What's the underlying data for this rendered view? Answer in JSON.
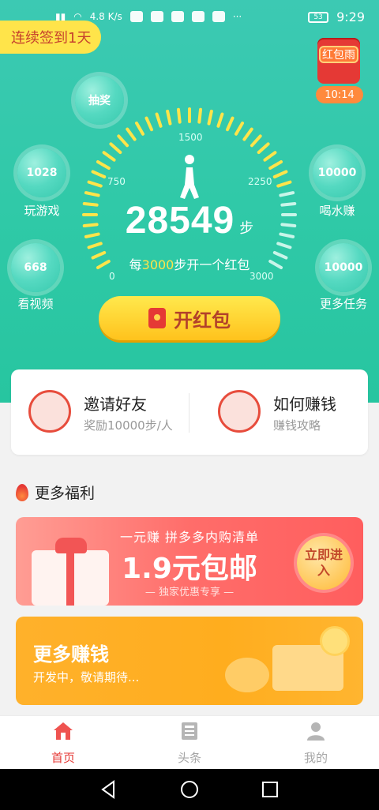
{
  "status": {
    "speed": "4.8 K/s",
    "battery": "53",
    "time": "9:29"
  },
  "checkin": {
    "label": "连续签到1天"
  },
  "redpack": {
    "label": "红包雨",
    "countdown": "10:14"
  },
  "bubbles": [
    {
      "value": "抽奖",
      "label": ""
    },
    {
      "value": "1028",
      "label": "玩游戏"
    },
    {
      "value": "668",
      "label": "看视频"
    },
    {
      "value": "10000",
      "label": "喝水赚"
    },
    {
      "value": "10000",
      "label": "更多任务"
    }
  ],
  "gauge": {
    "ticks": [
      "0",
      "750",
      "1500",
      "2250",
      "3000"
    ],
    "progress_fraction": 0.8
  },
  "steps": {
    "value": "28549",
    "unit": "步"
  },
  "rule": {
    "prefix": "每",
    "num": "3000",
    "suffix": "步开一个红包"
  },
  "open_button": {
    "label": "开红包"
  },
  "invite": {
    "title": "邀请好友",
    "subtitle": "奖励10000步/人"
  },
  "earn": {
    "title": "如何赚钱",
    "subtitle": "赚钱攻略"
  },
  "welfare": {
    "title": "更多福利"
  },
  "banner1": {
    "top": "一元赚    拼多多内购清单",
    "main": "1.9元包邮",
    "sub": "— 独家优惠专享 —",
    "button": "立即进入"
  },
  "banner2": {
    "title": "更多赚钱",
    "subtitle": "开发中，敬请期待..."
  },
  "tabs": [
    {
      "label": "首页",
      "icon": "home-icon",
      "active": true
    },
    {
      "label": "头条",
      "icon": "news-icon",
      "active": false
    },
    {
      "label": "我的",
      "icon": "profile-icon",
      "active": false
    }
  ],
  "colors": {
    "teal": "#2fc9a7",
    "yellow": "#ffe44a",
    "red": "#e53935",
    "orange": "#ffad1e"
  }
}
